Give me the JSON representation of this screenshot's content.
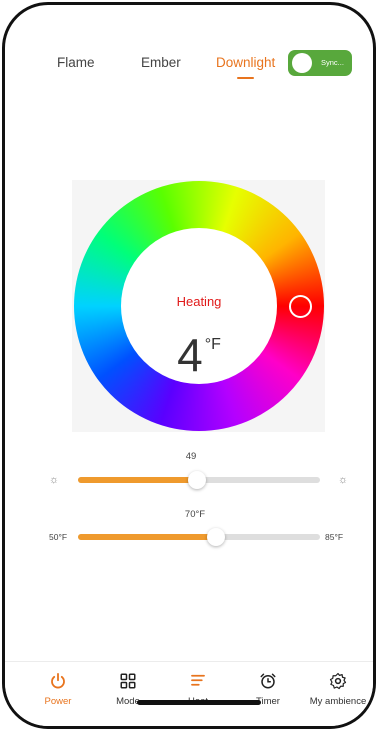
{
  "tabs": [
    {
      "label": "Flame",
      "active": false
    },
    {
      "label": "Ember",
      "active": false
    },
    {
      "label": "Downlight",
      "active": true
    }
  ],
  "sync_toggle": {
    "label": "Sync...",
    "state": "on",
    "color": "#58a83c"
  },
  "wheel": {
    "status": "Heating",
    "temperature": "4",
    "unit": "°F"
  },
  "brightness": {
    "value": "49",
    "fraction": 0.49,
    "min_icon": "sun-dim-icon",
    "max_icon": "sun-bright-icon"
  },
  "temperature_slider": {
    "value": "70°F",
    "min": "50°F",
    "max": "85°F",
    "fraction": 0.57
  },
  "nav": [
    {
      "label": "Power",
      "icon": "power-icon",
      "active": true
    },
    {
      "label": "Mode",
      "icon": "grid-icon",
      "active": false
    },
    {
      "label": "Heat",
      "icon": "heat-icon",
      "active": false
    },
    {
      "label": "Timer",
      "icon": "alarm-clock-icon",
      "active": false
    },
    {
      "label": "My ambience",
      "icon": "gear-icon",
      "active": false
    }
  ],
  "colors": {
    "accent": "#e8741e",
    "heating": "#e11a1a",
    "toggle_on": "#58a83c"
  }
}
